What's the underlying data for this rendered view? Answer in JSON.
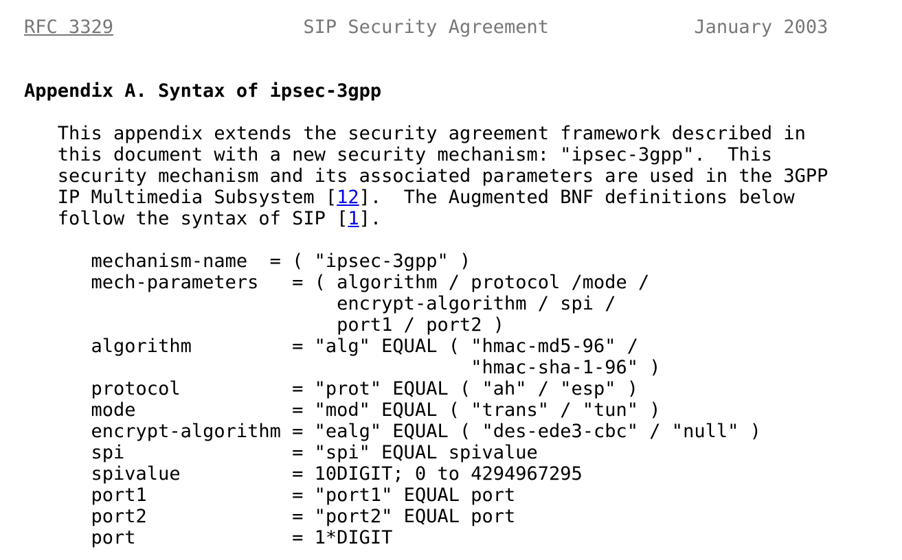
{
  "colors": {
    "background": "#ffffff",
    "text": "#000000",
    "header_grey": "#777777",
    "link_blue": "#0000ee"
  },
  "header": {
    "rfc_link": "RFC 3329",
    "title": "SIP Security Agreement",
    "date": "January 2003"
  },
  "heading": "Appendix A. Syntax of ipsec-3gpp",
  "paragraph": {
    "line1": "   This appendix extends the security agreement framework described in",
    "line2": "   this document with a new security mechanism: \"ipsec-3gpp\".  This",
    "line3": "   security mechanism and its associated parameters are used in the 3GPP",
    "line4_before": "   IP Multimedia Subsystem [",
    "ref_12": "12",
    "line4_after": "].  The Augmented BNF definitions below",
    "line5_before": "   follow the syntax of SIP [",
    "ref_1": "1",
    "line5_after": "]."
  },
  "bnf": {
    "lines": [
      "      mechanism-name  = ( \"ipsec-3gpp\" )",
      "      mech-parameters   = ( algorithm / protocol /mode /",
      "                            encrypt-algorithm / spi /",
      "                            port1 / port2 )",
      "      algorithm         = \"alg\" EQUAL ( \"hmac-md5-96\" /",
      "                                        \"hmac-sha-1-96\" )",
      "      protocol          = \"prot\" EQUAL ( \"ah\" / \"esp\" )",
      "      mode              = \"mod\" EQUAL ( \"trans\" / \"tun\" )",
      "      encrypt-algorithm = \"ealg\" EQUAL ( \"des-ede3-cbc\" / \"null\" )",
      "      spi               = \"spi\" EQUAL spivalue",
      "      spivalue          = 10DIGIT; 0 to 4294967295",
      "      port1             = \"port1\" EQUAL port",
      "      port2             = \"port2\" EQUAL port",
      "      port              = 1*DIGIT"
    ]
  }
}
